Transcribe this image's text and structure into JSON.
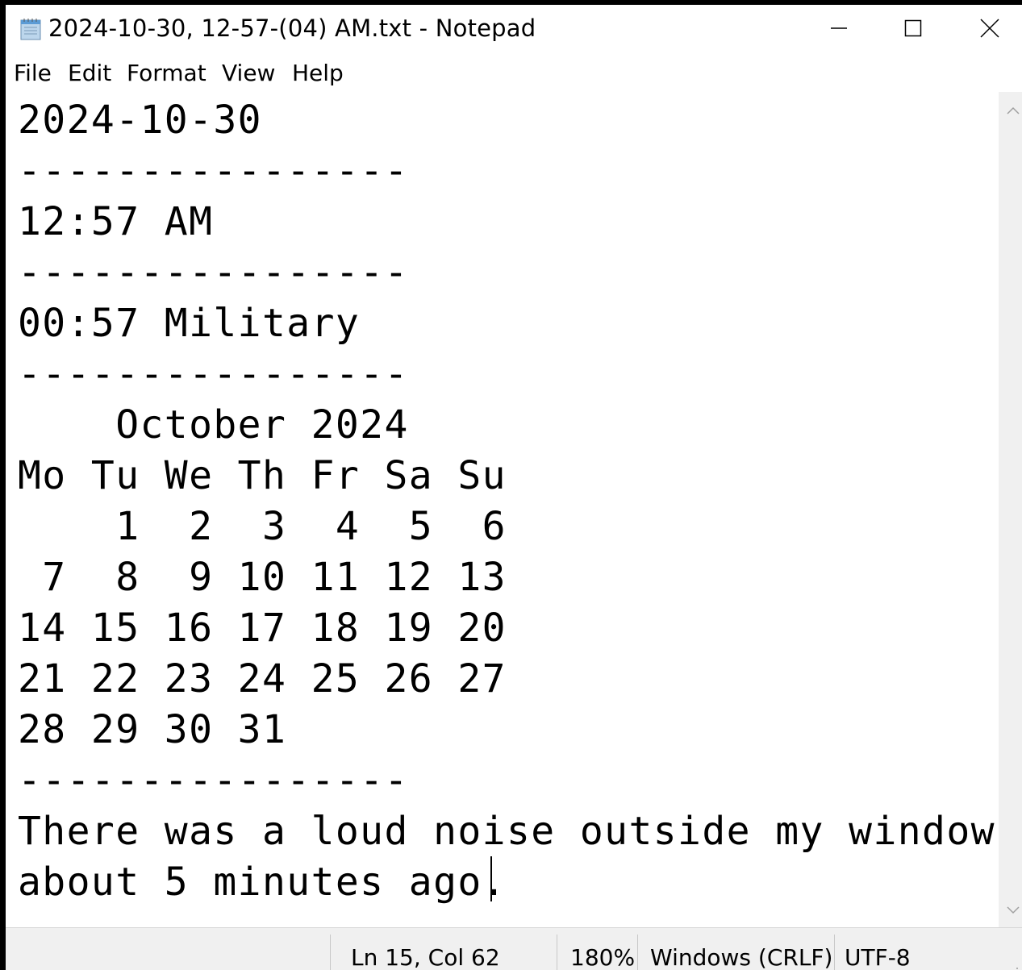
{
  "window": {
    "title": "2024-10-30, 12-57-(04) AM.txt - Notepad",
    "icon": "notepad-icon",
    "controls": [
      "minimize-icon",
      "maximize-icon",
      "close-icon"
    ]
  },
  "menu": {
    "items": [
      {
        "label": "File"
      },
      {
        "label": "Edit"
      },
      {
        "label": "Format"
      },
      {
        "label": "View"
      },
      {
        "label": "Help"
      }
    ]
  },
  "document": {
    "text": "2024-10-30\n----------------\n12:57 AM\n----------------\n00:57 Military\n----------------\n    October 2024\nMo Tu We Th Fr Sa Su\n    1  2  3  4  5  6\n 7  8  9 10 11 12 13\n14 15 16 17 18 19 20\n21 22 23 24 25 26 27\n28 29 30 31\n----------------\nThere was a loud noise outside my window\nabout 5 minutes ago."
  },
  "status": {
    "position": "Ln 15, Col 62",
    "zoom": "180%",
    "line_ending": "Windows (CRLF)",
    "encoding": "UTF-8"
  }
}
